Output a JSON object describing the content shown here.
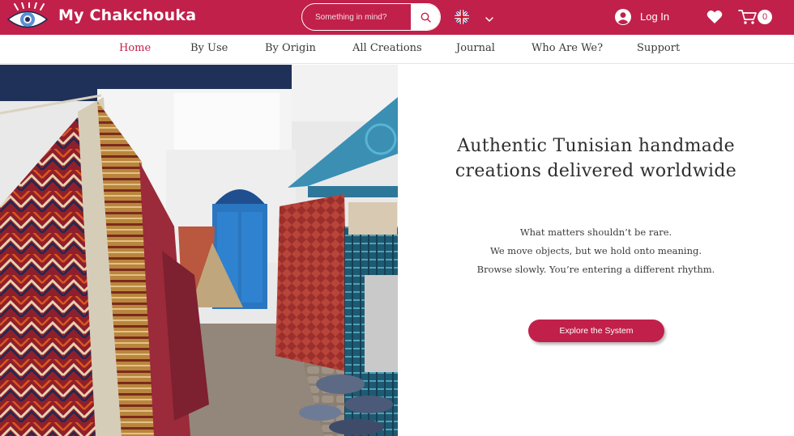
{
  "header": {
    "brand": "My Chakchouka",
    "logo_icon": "evil-eye-logo-icon",
    "search": {
      "placeholder": "Something in mind?",
      "value": "",
      "button_icon": "search-icon"
    },
    "language": {
      "flag_icon": "uk-flag-icon",
      "dropdown_icon": "chevron-down-icon"
    },
    "login_label": "Log In",
    "login_icon": "user-avatar-icon",
    "wishlist_icon": "heart-icon",
    "cart_icon": "cart-icon",
    "cart_count": "0"
  },
  "nav": {
    "items": [
      {
        "label": "Home",
        "active": true
      },
      {
        "label": "By Use",
        "active": false
      },
      {
        "label": "By Origin",
        "active": false
      },
      {
        "label": "All Creations",
        "active": false
      },
      {
        "label": "Journal",
        "active": false
      },
      {
        "label": "Who Are We?",
        "active": false
      },
      {
        "label": "Support",
        "active": false
      }
    ]
  },
  "hero": {
    "headline_lines": [
      "Authentic Tunisian handmade",
      "creations delivered worldwide"
    ],
    "tagline_lines": [
      "What matters shouldn’t be rare.",
      "We move objects, but we hold onto meaning.",
      "Browse slowly. You’re entering a different rhythm."
    ],
    "cta_label": "Explore the System"
  },
  "colors": {
    "brand": "#c1204a",
    "text": "#2e2e2e",
    "white": "#ffffff"
  }
}
